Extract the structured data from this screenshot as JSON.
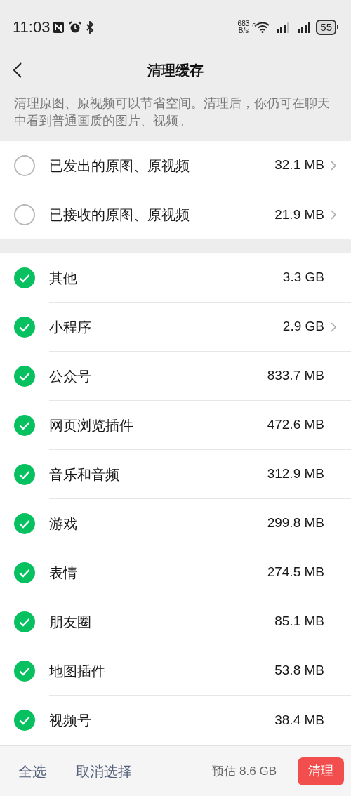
{
  "status_bar": {
    "time": "11:03",
    "net_speed": "683",
    "net_unit": "B/s",
    "wifi_label": "6",
    "battery": "55"
  },
  "header": {
    "title": "清理缓存"
  },
  "description": "清理原图、原视频可以节省空间。清理后，你仍可在聊天中看到普通画质的图片、视频。",
  "media_items": [
    {
      "label": "已发出的原图、原视频",
      "size": "32.1 MB",
      "checked": false,
      "chevron": true
    },
    {
      "label": "已接收的原图、原视频",
      "size": "21.9 MB",
      "checked": false,
      "chevron": true
    }
  ],
  "cache_items": [
    {
      "label": "其他",
      "size": "3.3 GB",
      "checked": true,
      "chevron": false
    },
    {
      "label": "小程序",
      "size": "2.9 GB",
      "checked": true,
      "chevron": true
    },
    {
      "label": "公众号",
      "size": "833.7 MB",
      "checked": true,
      "chevron": false
    },
    {
      "label": "网页浏览插件",
      "size": "472.6 MB",
      "checked": true,
      "chevron": false
    },
    {
      "label": "音乐和音频",
      "size": "312.9 MB",
      "checked": true,
      "chevron": false
    },
    {
      "label": "游戏",
      "size": "299.8 MB",
      "checked": true,
      "chevron": false
    },
    {
      "label": "表情",
      "size": "274.5 MB",
      "checked": true,
      "chevron": false
    },
    {
      "label": "朋友圈",
      "size": "85.1 MB",
      "checked": true,
      "chevron": false
    },
    {
      "label": "地图插件",
      "size": "53.8 MB",
      "checked": true,
      "chevron": false
    },
    {
      "label": "视频号",
      "size": "38.4 MB",
      "checked": true,
      "chevron": false
    }
  ],
  "bottom_bar": {
    "select_all": "全选",
    "deselect": "取消选择",
    "estimate": "预估 8.6 GB",
    "clean_button": "清理"
  }
}
